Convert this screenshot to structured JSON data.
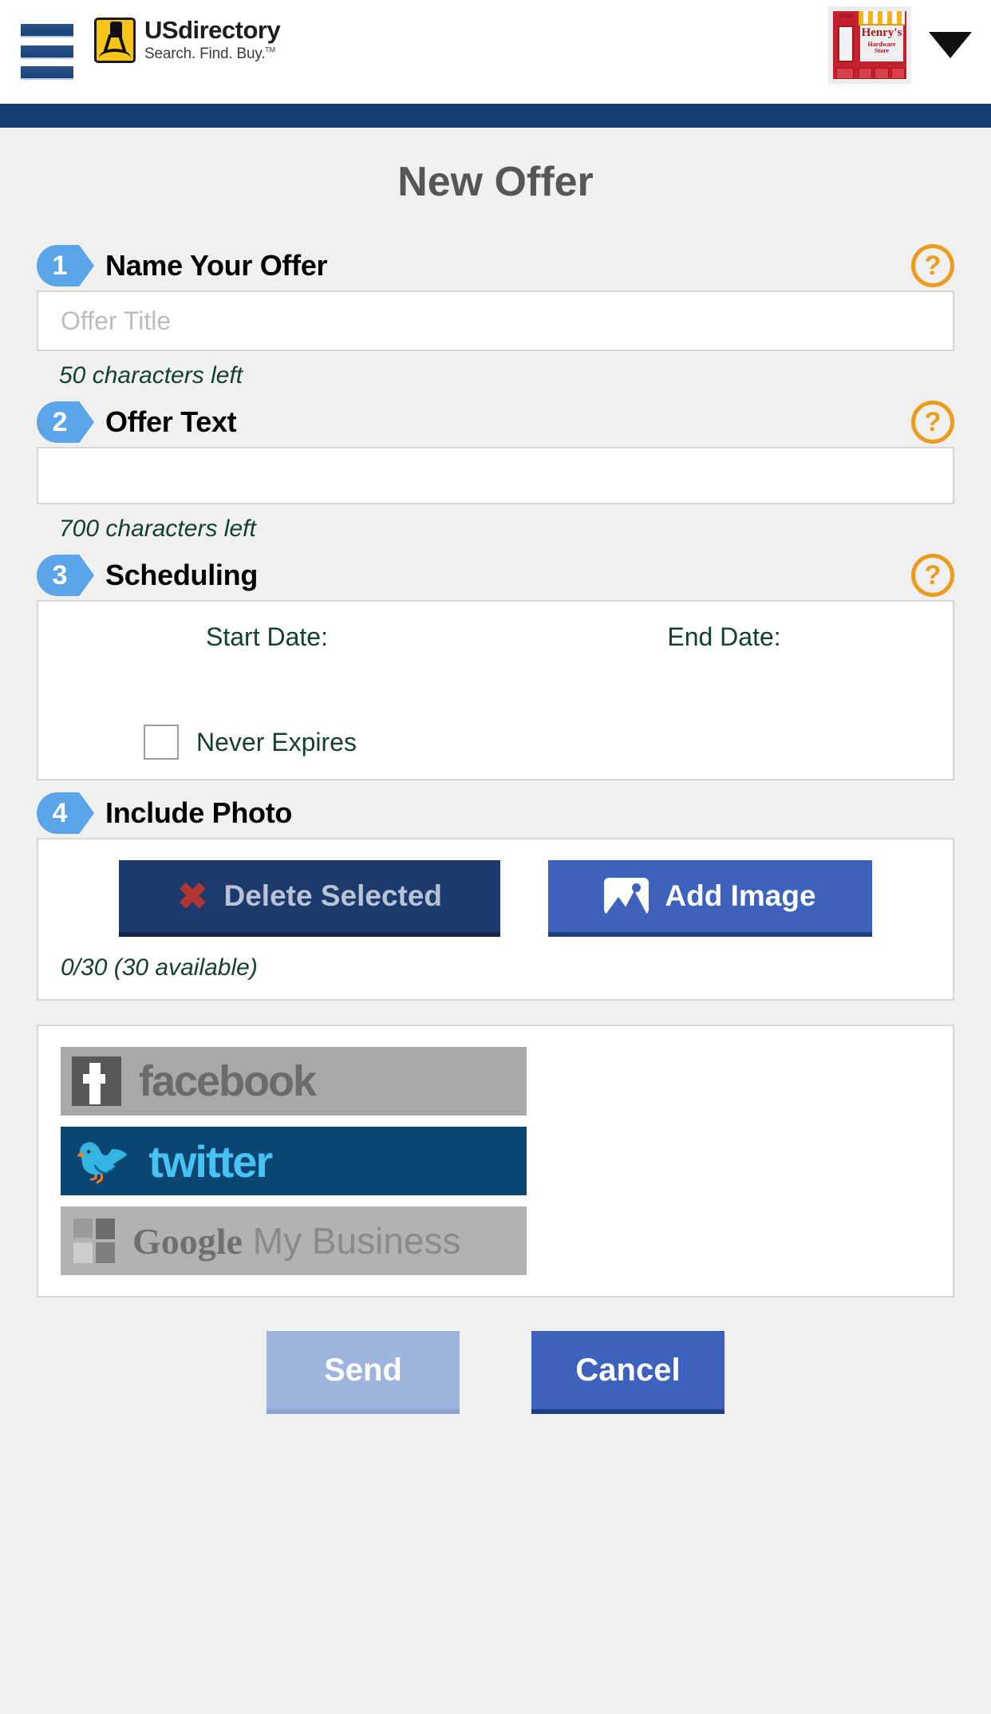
{
  "header": {
    "menu_icon": "hamburger-icon",
    "brand_name": "USdirectory",
    "brand_tagline": "Search. Find. Buy.",
    "brand_tagline_mark": "TM",
    "business": {
      "name_line1": "Henry's",
      "name_line2": "Hardware Store",
      "open_sign": "OPEN"
    },
    "dropdown_icon": "chevron-down-icon"
  },
  "page": {
    "title": "New Offer"
  },
  "steps": [
    {
      "number": "1",
      "title": "Name Your Offer",
      "help_icon": "question-mark-icon",
      "input_value": "",
      "input_placeholder": "Offer Title",
      "counter": "50 characters left"
    },
    {
      "number": "2",
      "title": "Offer Text",
      "help_icon": "question-mark-icon",
      "input_value": "",
      "counter": "700 characters left"
    },
    {
      "number": "3",
      "title": "Scheduling",
      "help_icon": "question-mark-icon"
    },
    {
      "number": "4",
      "title": "Include Photo"
    }
  ],
  "scheduling": {
    "start_date_label": "Start Date:",
    "start_date_value": "",
    "end_date_label": "End Date:",
    "end_date_value": "",
    "never_expires_label": "Never Expires",
    "never_expires_checked": false
  },
  "photo": {
    "delete_label": "Delete Selected",
    "delete_icon": "red-x-icon",
    "add_label": "Add Image",
    "add_icon": "picture-icon",
    "counter": "0/30 (30 available)"
  },
  "social": [
    {
      "key": "facebook",
      "label": "facebook",
      "registered": "®",
      "enabled": false
    },
    {
      "key": "twitter",
      "label": "twitter",
      "icon": "twitter-bird-icon",
      "enabled": true
    },
    {
      "key": "google_my_business",
      "label": "Google",
      "label2": " My Business",
      "enabled": false
    }
  ],
  "footer": {
    "send_label": "Send",
    "cancel_label": "Cancel"
  },
  "colors": {
    "header_bar": "#153e75",
    "step_badge": "#5aa5e8",
    "help_orange": "#eb9c1c",
    "counter_green": "#14402e",
    "primary_blue": "#3c62bd",
    "disabled_navy": "#1c3a6b",
    "send_disabled": "#9db4dd",
    "twitter_bg": "#0b4572",
    "twitter_fg": "#46c3f2"
  }
}
